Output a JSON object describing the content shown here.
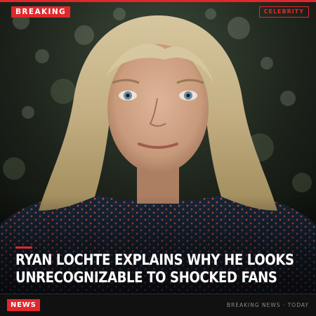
{
  "header": {
    "breaking_label": "BREAKING",
    "category_label": "CELEBRITY"
  },
  "article": {
    "headline_line1": "RYAN LOCHTE EXPLAINS WHY HE LOOKS",
    "headline_line2": "UNRECOGNIZABLE TO SHOCKED FANS"
  },
  "footer": {
    "news_label": "NEWS",
    "source_text": "BREAKING NEWS · TODAY"
  },
  "colors": {
    "accent": "#e0282c",
    "background": "#0b0c0b",
    "headline_text": "#ffffff",
    "footer_text": "#8a8a8a"
  }
}
